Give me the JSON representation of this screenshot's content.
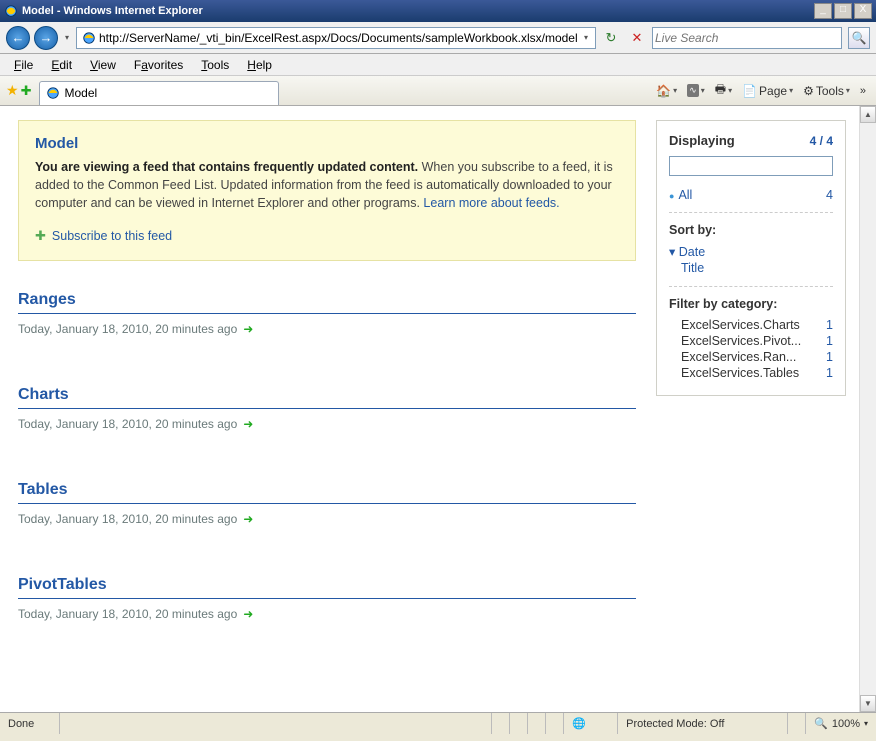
{
  "window": {
    "title": "Model - Windows Internet Explorer"
  },
  "nav": {
    "url": "http://ServerName/_vti_bin/ExcelRest.aspx/Docs/Documents/sampleWorkbook.xlsx/model",
    "search_placeholder": "Live Search"
  },
  "menu": {
    "file": "File",
    "edit": "Edit",
    "view": "View",
    "favorites": "Favorites",
    "tools": "Tools",
    "help": "Help"
  },
  "tab": {
    "title": "Model"
  },
  "cmd": {
    "page": "Page",
    "tools": "Tools"
  },
  "feedbox": {
    "title": "Model",
    "bold": "You are viewing a feed that contains frequently updated content.",
    "body": " When you subscribe to a feed, it is added to the Common Feed List. Updated information from the feed is automatically downloaded to your computer and can be viewed in Internet Explorer and other programs. ",
    "learn": "Learn more about feeds.",
    "subscribe": "Subscribe to this feed"
  },
  "items": [
    {
      "title": "Ranges",
      "ts": "Today, January 18, 2010, 20 minutes ago"
    },
    {
      "title": "Charts",
      "ts": "Today, January 18, 2010, 20 minutes ago"
    },
    {
      "title": "Tables",
      "ts": "Today, January 18, 2010, 20 minutes ago"
    },
    {
      "title": "PivotTables",
      "ts": "Today, January 18, 2010, 20 minutes ago"
    }
  ],
  "side": {
    "displaying": "Displaying",
    "count": "4 / 4",
    "all": "All",
    "all_count": "4",
    "sort_by": "Sort by:",
    "sort": {
      "date": "Date",
      "title": "Title"
    },
    "filter_hdr": "Filter by category:",
    "cats": [
      {
        "name": "ExcelServices.Charts",
        "n": "1"
      },
      {
        "name": "ExcelServices.Pivot...",
        "n": "1"
      },
      {
        "name": "ExcelServices.Ran...",
        "n": "1"
      },
      {
        "name": "ExcelServices.Tables",
        "n": "1"
      }
    ]
  },
  "status": {
    "done": "Done",
    "protected": "Protected Mode: Off",
    "zoom": "100%"
  }
}
